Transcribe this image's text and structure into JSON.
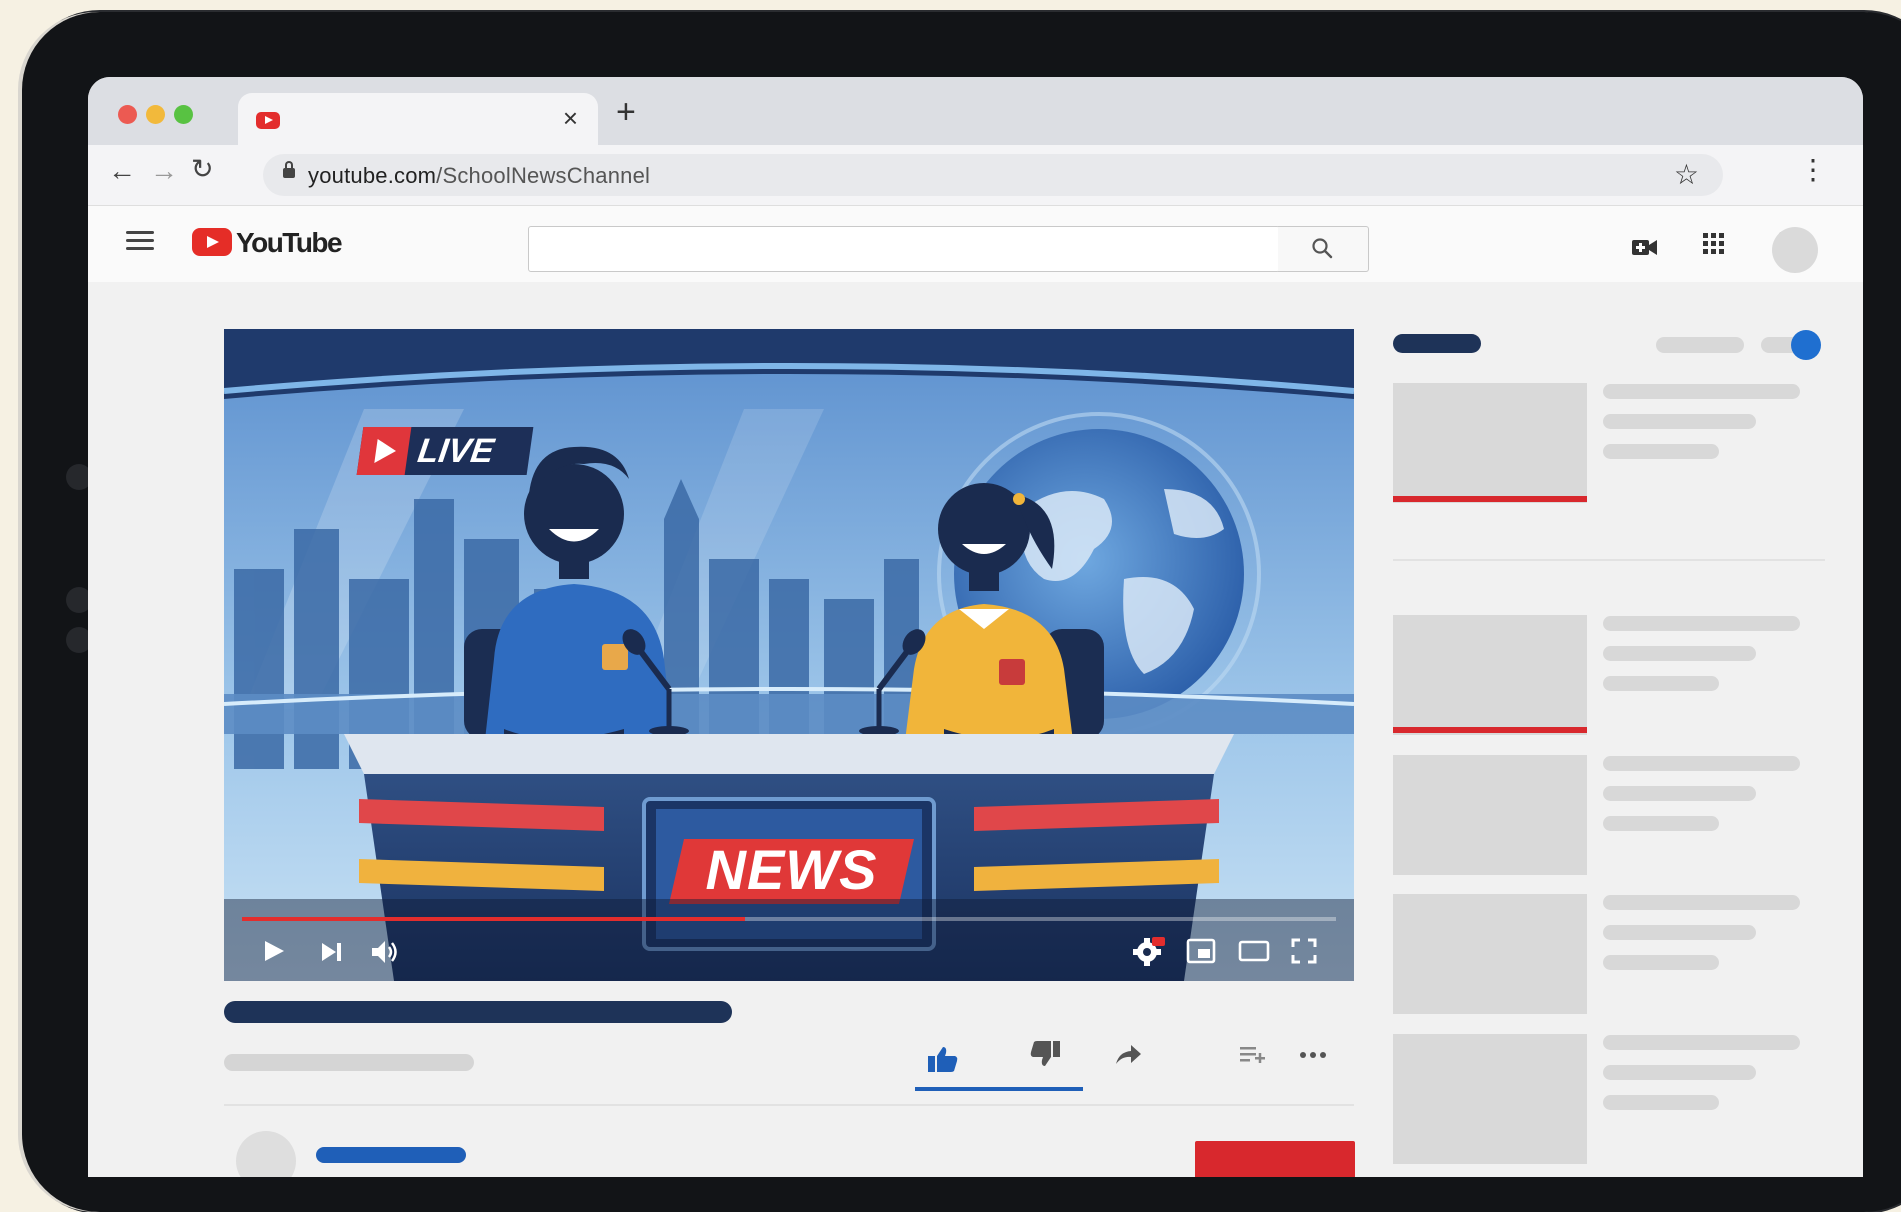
{
  "browser": {
    "url_host": "youtube.com",
    "url_path": "/SchoolNewsChannel"
  },
  "youtube": {
    "logo_text": "YouTube"
  },
  "video": {
    "live_label": "LIVE",
    "desk_sign": "NEWS",
    "progress": 0.46
  },
  "colors": {
    "youtube_red": "#e32d2d",
    "toggle_blue": "#1f6fd0",
    "dark_navy": "#1e3358"
  },
  "icons": {
    "tabbar": [
      "youtube-favicon-icon",
      "close-icon",
      "plus-icon"
    ],
    "navbar": [
      "back-arrow-icon",
      "forward-arrow-icon",
      "reload-icon",
      "lock-icon",
      "star-icon",
      "more-vert-icon"
    ],
    "header": [
      "hamburger-menu-icon",
      "search-icon",
      "video-camera-icon",
      "apps-grid-icon",
      "bell-icon"
    ],
    "player": [
      "play-icon",
      "next-icon",
      "volume-icon",
      "settings-icon",
      "miniplayer-icon",
      "theater-icon",
      "fullscreen-icon"
    ],
    "actions": [
      "thumbs-up-icon",
      "thumbs-down-icon",
      "share-icon",
      "save-playlist-icon",
      "more-horiz-icon"
    ]
  }
}
